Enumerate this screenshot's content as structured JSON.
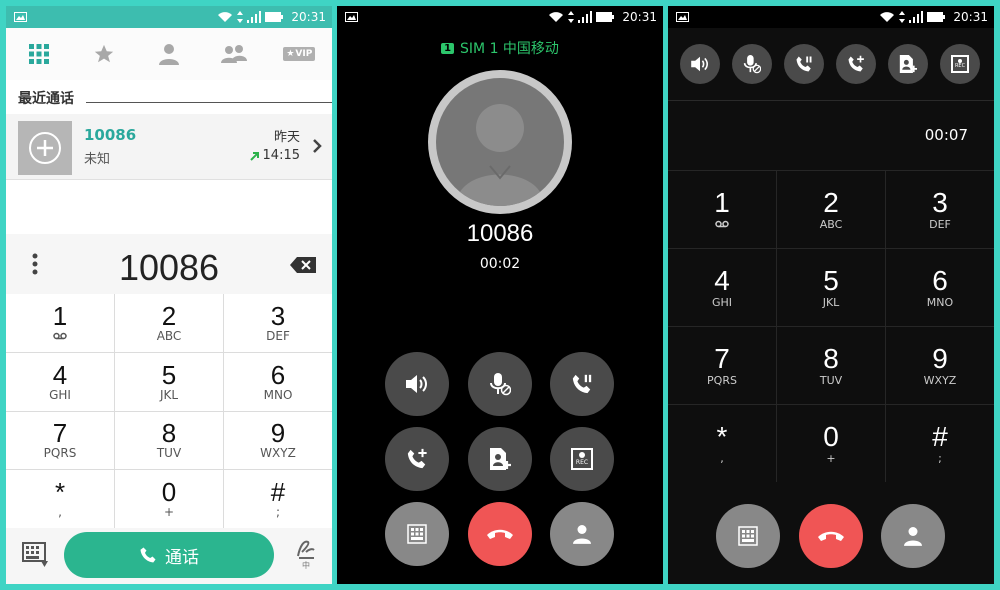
{
  "status": {
    "time": "20:31"
  },
  "dialer": {
    "recent_title": "最近通话",
    "recent": {
      "number": "10086",
      "subtitle": "未知",
      "day": "昨天",
      "time": "14:15"
    },
    "tabs": [
      "dialpad-tab-icon",
      "favorites-tab-icon",
      "contacts-tab-icon",
      "groups-tab-icon",
      "vip-tab-icon"
    ],
    "vip_label": "VIP",
    "input_value": "10086",
    "keys": [
      {
        "d": "1",
        "l": "voicemail"
      },
      {
        "d": "2",
        "l": "ABC"
      },
      {
        "d": "3",
        "l": "DEF"
      },
      {
        "d": "4",
        "l": "GHI"
      },
      {
        "d": "5",
        "l": "JKL"
      },
      {
        "d": "6",
        "l": "MNO"
      },
      {
        "d": "7",
        "l": "PQRS"
      },
      {
        "d": "8",
        "l": "TUV"
      },
      {
        "d": "9",
        "l": "WXYZ"
      },
      {
        "d": "*",
        "l": ","
      },
      {
        "d": "0",
        "l": "+"
      },
      {
        "d": "#",
        "l": ";"
      }
    ],
    "call_label": "通话",
    "handwriting_label": "中"
  },
  "incall": {
    "sim_badge": "1",
    "sim_text": "SIM 1  中国移动",
    "number": "10086",
    "duration": "00:02",
    "rec_label": "REC"
  },
  "incall_keypad": {
    "duration": "00:07",
    "keys": [
      {
        "d": "1",
        "l": "voicemail"
      },
      {
        "d": "2",
        "l": "ABC"
      },
      {
        "d": "3",
        "l": "DEF"
      },
      {
        "d": "4",
        "l": "GHI"
      },
      {
        "d": "5",
        "l": "JKL"
      },
      {
        "d": "6",
        "l": "MNO"
      },
      {
        "d": "7",
        "l": "PQRS"
      },
      {
        "d": "8",
        "l": "TUV"
      },
      {
        "d": "9",
        "l": "WXYZ"
      },
      {
        "d": "*",
        "l": ","
      },
      {
        "d": "0",
        "l": "+"
      },
      {
        "d": "#",
        "l": ";"
      }
    ],
    "rec_label": "REC"
  },
  "colors": {
    "accent": "#2bb58f",
    "teal": "#3dbdaf",
    "end_call": "#f05555",
    "sim_green": "#2cc56b"
  }
}
